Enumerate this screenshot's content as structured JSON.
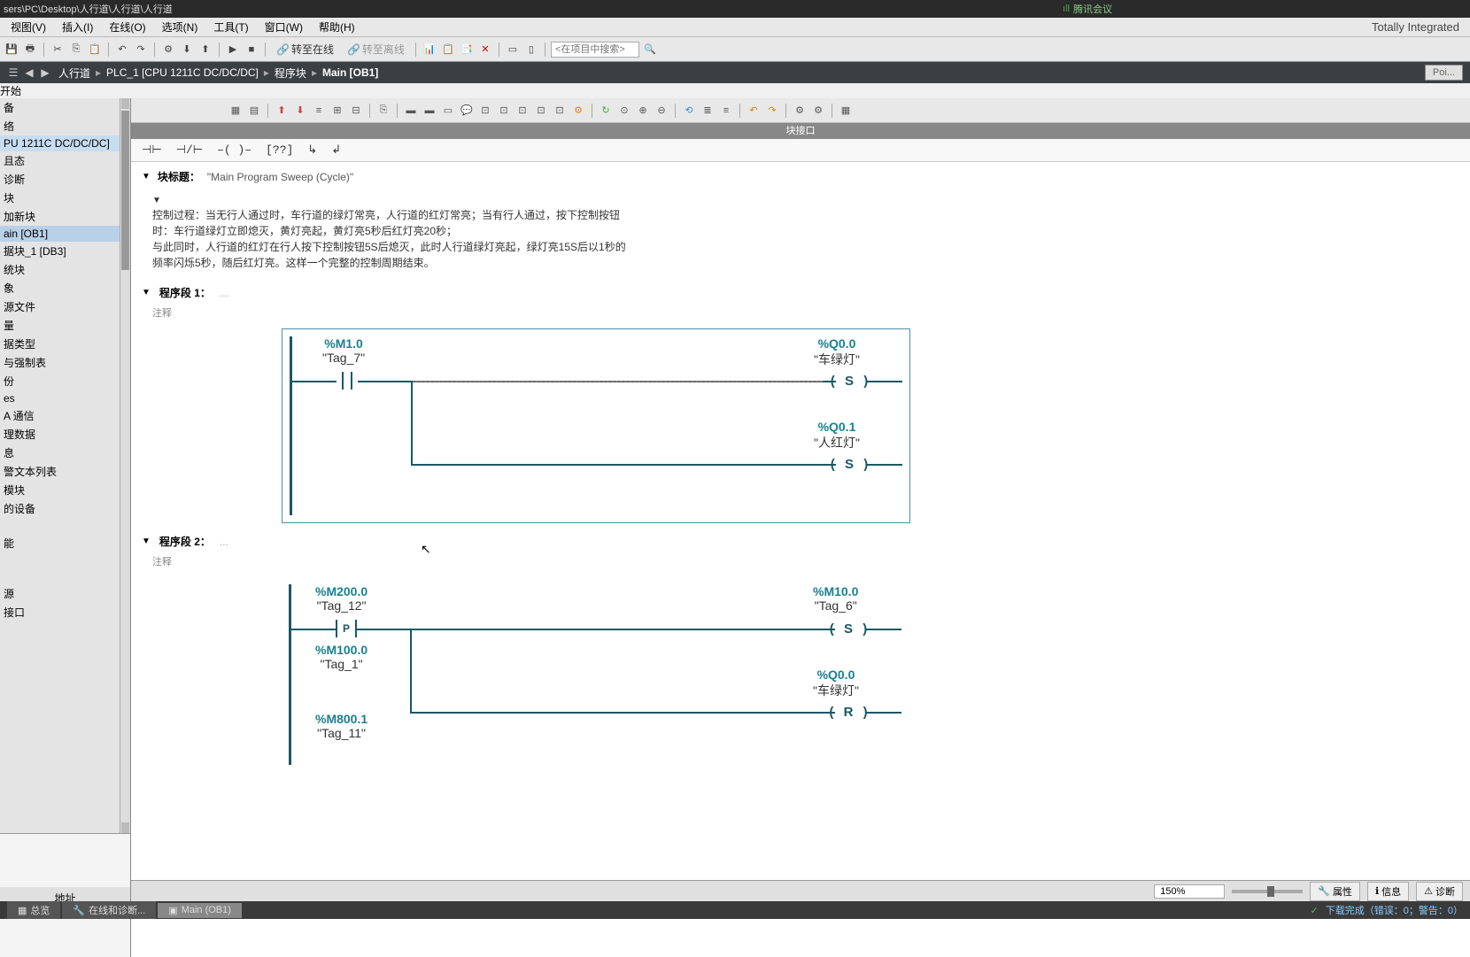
{
  "titlebar": {
    "path": "sers\\PC\\Desktop\\人行道\\人行道\\人行道",
    "meeting": "腾讯会议"
  },
  "menu": {
    "items": [
      "视图(V)",
      "插入(I)",
      "在线(O)",
      "选项(N)",
      "工具(T)",
      "窗口(W)",
      "帮助(H)"
    ],
    "brand": "Totally Integrated"
  },
  "toolbar": {
    "go_online": "转至在线",
    "go_offline": "转至离线",
    "search_placeholder": "<在项目中搜索>"
  },
  "breadcrumb": {
    "items": [
      "人行道",
      "PLC_1 [CPU 1211C DC/DC/DC]",
      "程序块",
      "Main [OB1]"
    ],
    "poi": "Poi...",
    "start": "开始"
  },
  "tree": {
    "items": [
      "备",
      "络",
      "PU 1211C DC/DC/DC]",
      "且态",
      "诊断",
      "块",
      "加新块",
      "ain [OB1]",
      "据块_1 [DB3]",
      "统块",
      "象",
      "源文件",
      "量",
      "据类型",
      "与强制表",
      "份",
      "es",
      "A 通信",
      "理数据",
      "息",
      "警文本列表",
      "模块",
      "的设备",
      "",
      "能",
      "",
      "",
      "源",
      "接口"
    ],
    "highlighted_index": 2,
    "selected_index": 7,
    "bottom_header": "地址"
  },
  "interface_label": "块接口",
  "block": {
    "title_label": "块标题：",
    "title": "\"Main Program Sweep (Cycle)\"",
    "desc_lines": [
      "控制过程：当无行人通过时，车行道的绿灯常亮，人行道的红灯常亮；当有行人通过，按下控制按钮",
      "时：车行道绿灯立即熄灭，黄灯亮起，黄灯亮5秒后红灯亮20秒；",
      "与此同时，人行道的红灯在行人按下控制按钮5S后熄灭，此时人行道绿灯亮起，绿灯亮15S后以1秒的",
      "频率闪烁5秒，随后红灯亮。这样一个完整的控制周期结束。"
    ]
  },
  "networks": [
    {
      "label": "程序段 1：",
      "comment": "注释",
      "rungs": [
        {
          "input_addr": "%M1.0",
          "input_name": "\"Tag_7\"",
          "out_addr": "%Q0.0",
          "out_name": "\"车绿灯\"",
          "coil": "S"
        },
        {
          "out_addr": "%Q0.1",
          "out_name": "\"人红灯\"",
          "coil": "S"
        }
      ]
    },
    {
      "label": "程序段 2：",
      "comment": "注释",
      "rungs": [
        {
          "input_addr": "%M200.0",
          "input_name": "\"Tag_12\"",
          "ptrig": "P",
          "out_addr": "%M10.0",
          "out_name": "\"Tag_6\"",
          "coil": "S"
        },
        {
          "input_addr": "%M100.0",
          "input_name": "\"Tag_1\"",
          "out_addr": "%Q0.0",
          "out_name": "\"车绿灯\"",
          "coil": "R"
        },
        {
          "input_addr": "%M800.1",
          "input_name": "\"Tag_11\""
        }
      ]
    }
  ],
  "bottom": {
    "zoom": "150%",
    "props": "属性",
    "info": "信息",
    "diag": "诊断"
  },
  "statusbar": {
    "tabs": [
      "总览",
      "在线和诊断...",
      "Main (OB1)"
    ],
    "download": "下载完成（错误：0；警告：0）"
  }
}
